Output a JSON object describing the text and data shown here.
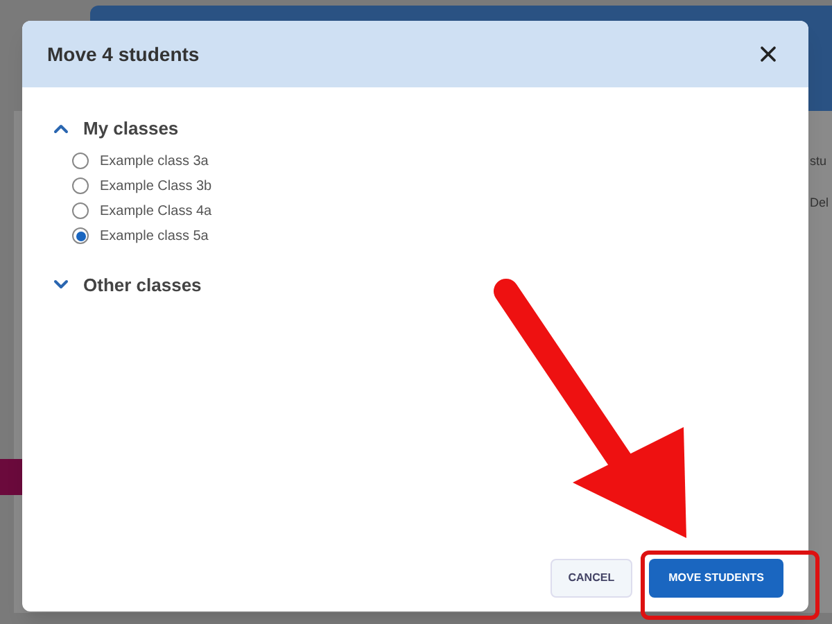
{
  "background": {
    "texts": [
      "stu",
      "Del"
    ]
  },
  "dialog": {
    "title": "Move 4 students",
    "groups": [
      {
        "label": "My classes",
        "expanded": true,
        "options": [
          {
            "label": "Example class 3a",
            "selected": false
          },
          {
            "label": "Example Class 3b",
            "selected": false
          },
          {
            "label": "Example Class 4a",
            "selected": false
          },
          {
            "label": "Example class 5a",
            "selected": true
          }
        ]
      },
      {
        "label": "Other classes",
        "expanded": false
      }
    ],
    "buttons": [
      {
        "label": "CANCEL",
        "kind": "secondary"
      },
      {
        "label": "MOVE STUDENTS",
        "kind": "primary"
      }
    ]
  }
}
